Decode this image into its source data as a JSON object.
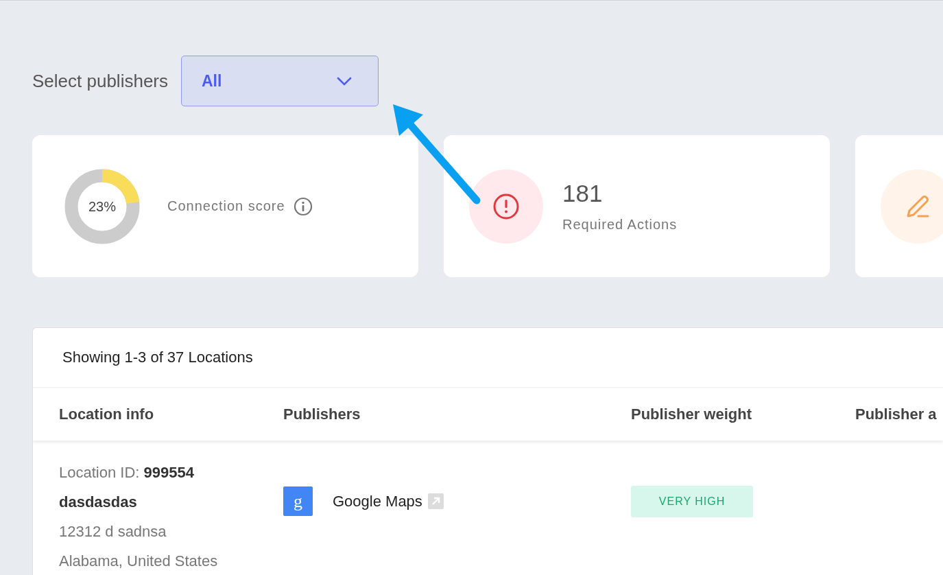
{
  "filter": {
    "label": "Select publishers",
    "value": "All"
  },
  "cards": [
    {
      "kind": "score",
      "reading": "23%",
      "level": 0.23,
      "label": "Connection score"
    },
    {
      "kind": "alert",
      "value": "181",
      "label": "Required Actions"
    },
    {
      "kind": "edit"
    }
  ],
  "table": {
    "summary": "Showing 1-3 of 37 Locations",
    "columns": [
      "Location info",
      "Publishers",
      "Publisher weight",
      "Publisher a"
    ],
    "rows": [
      {
        "location_id": "Location ID: **999554**",
        "name": "dasdasdas",
        "address": "12312 d sadnsa",
        "region": "Alabama, United States",
        "publisher": {
          "logo_letter": "g",
          "name": "Google Maps"
        },
        "weight": "VERY HIGH"
      }
    ]
  }
}
